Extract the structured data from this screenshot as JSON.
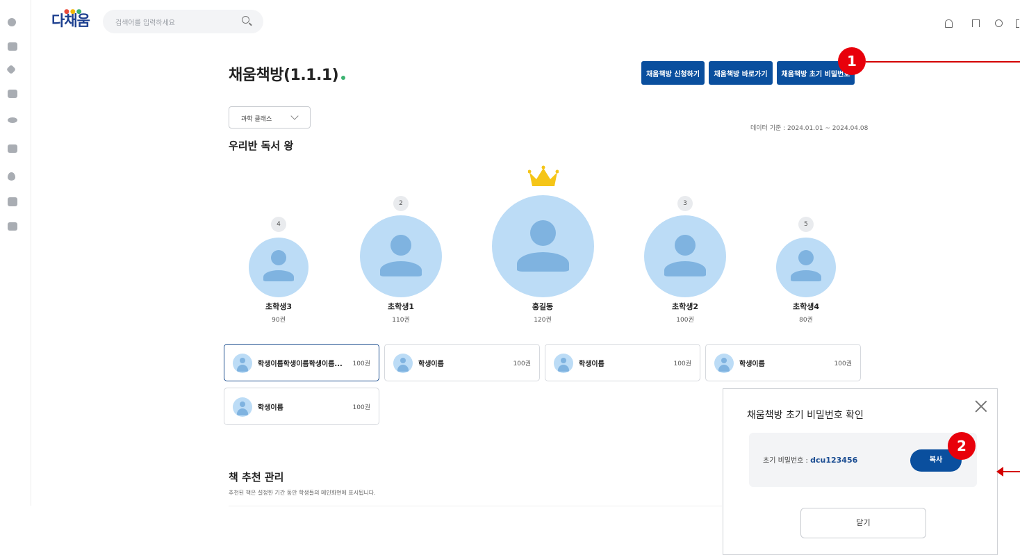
{
  "header": {
    "logo_text": "다채움",
    "search_placeholder": "검색어를 입력하세요"
  },
  "page": {
    "title": "채움책방(1.1.1)",
    "buttons": [
      "채움책방 신청하기",
      "채움책방 바로가기",
      "채움책방 초기 비밀번호"
    ],
    "class_select": "과학 클래스",
    "data_range": "데이터 기준 : 2024.01.01 ~ 2024.04.08",
    "section_title": "우리반 독서 왕"
  },
  "ranking": [
    {
      "rank": "4",
      "name": "초학생3",
      "count": "90권"
    },
    {
      "rank": "2",
      "name": "초학생1",
      "count": "110권"
    },
    {
      "rank": "",
      "name": "홍길동",
      "count": "120권"
    },
    {
      "rank": "3",
      "name": "초학생2",
      "count": "100권"
    },
    {
      "rank": "5",
      "name": "초학생4",
      "count": "80권"
    }
  ],
  "students": [
    {
      "name": "학생이름학생이름학생이름...",
      "count": "100권"
    },
    {
      "name": "학생이름",
      "count": "100권"
    },
    {
      "name": "학생이름",
      "count": "100권"
    },
    {
      "name": "학생이름",
      "count": "100권"
    },
    {
      "name": "학생이름",
      "count": "100권"
    }
  ],
  "recommend": {
    "title": "책 추천 관리",
    "subtitle": "추천된 책은 설정한 기간 동안 학생들의 메인화면에 표시됩니다."
  },
  "modal": {
    "title": "채움책방 초기 비밀번호 확인",
    "password_label": "초기 비밀번호 : ",
    "password_value": "dcu123456",
    "copy_button": "복사",
    "close_button": "닫기"
  },
  "markers": [
    "1",
    "2"
  ],
  "colors": {
    "primary": "#0a4f9e",
    "marker": "#e8000b",
    "avatar_bg": "#bcdcf6",
    "avatar_fg": "#7fb3e0",
    "crown": "#f5c518"
  }
}
